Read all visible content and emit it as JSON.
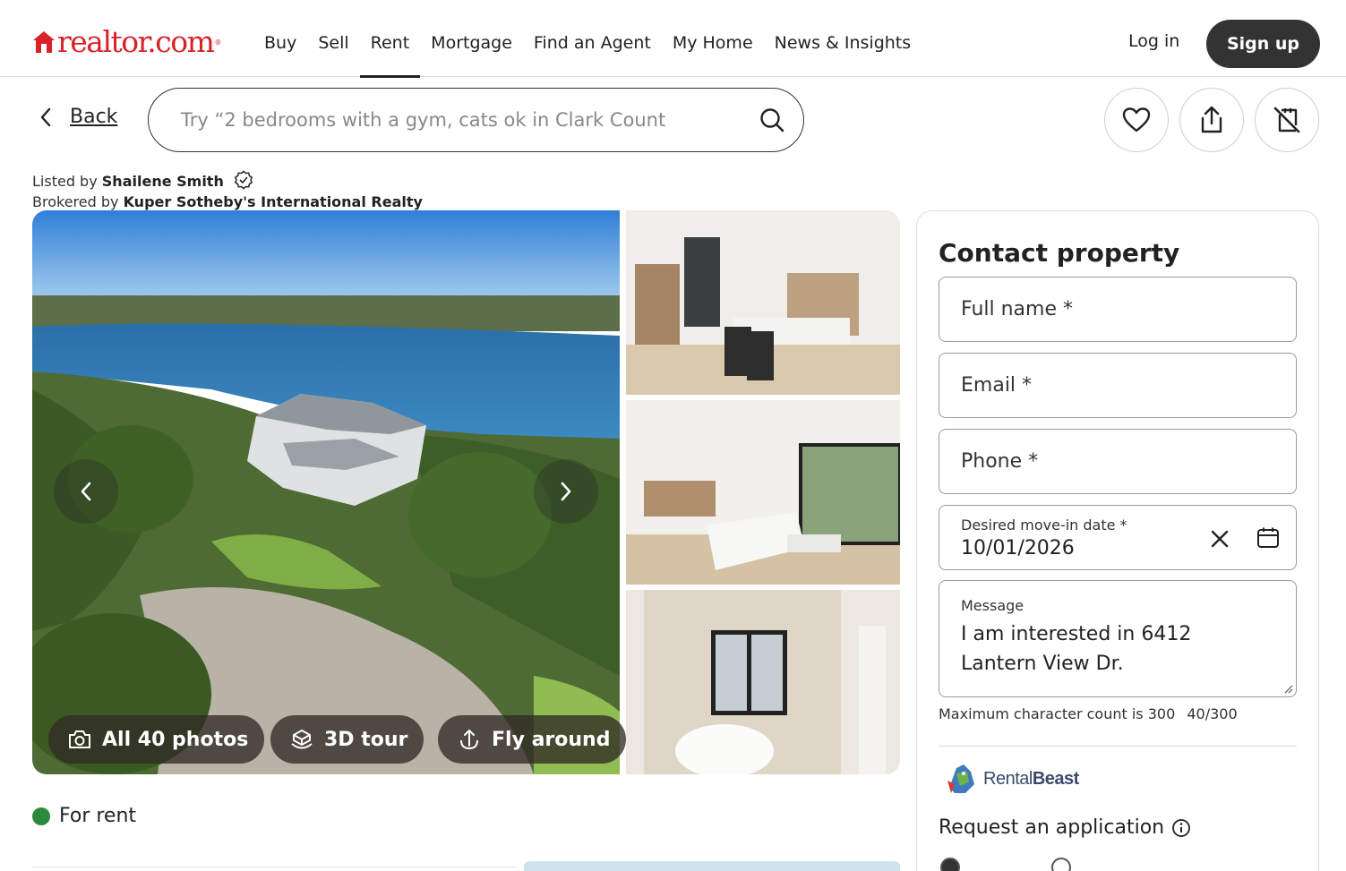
{
  "brand": {
    "name": "realtor.com",
    "color": "#d92228"
  },
  "nav": {
    "items": [
      {
        "label": "Buy"
      },
      {
        "label": "Sell"
      },
      {
        "label": "Rent",
        "active": true
      },
      {
        "label": "Mortgage"
      },
      {
        "label": "Find an Agent"
      },
      {
        "label": "My Home"
      },
      {
        "label": "News & Insights"
      }
    ],
    "login": "Log in",
    "signup": "Sign up"
  },
  "toolbar": {
    "back": "Back",
    "search_placeholder": "Try “2 bedrooms with a gym, cats ok in Clark Count",
    "actions": [
      "heart-icon",
      "share-icon",
      "hide-icon"
    ]
  },
  "listing": {
    "listed_by_label": "Listed by",
    "agent": "Shailene Smith",
    "brokered_by_label": "Brokered by",
    "broker": "Kuper Sotheby's International Realty",
    "status": "For rent",
    "status_color": "#2c8a3d"
  },
  "gallery": {
    "photos_label": "All 40 photos",
    "tour_label": "3D tour",
    "fly_label": "Fly around"
  },
  "contact": {
    "title": "Contact property",
    "full_name": "Full name *",
    "email": "Email *",
    "phone": "Phone *",
    "date_label": "Desired move-in date *",
    "date_value": "10/01/2026",
    "message_label": "Message",
    "message_value": "I am interested in 6412 Lantern View Dr.",
    "max_chars": "Maximum character count is 300",
    "char_count": "40/300",
    "partner_a": "Rental",
    "partner_b": "Beast",
    "request_label": "Request an application"
  }
}
